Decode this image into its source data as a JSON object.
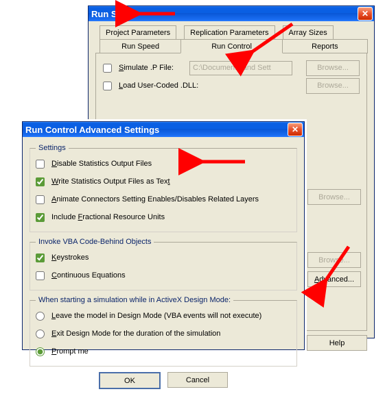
{
  "runSetup": {
    "title": "Run Setup",
    "tabs": {
      "row1": [
        "Project Parameters",
        "Replication Parameters",
        "Array Sizes"
      ],
      "row2": [
        "Run Speed",
        "Run Control",
        "Reports"
      ]
    },
    "simulatePFile": "Simulate .P File:",
    "simulatePath": "C:\\Documents and Sett",
    "loadDll": "Load User-Coded .DLL:",
    "browse": "Browse...",
    "advanced": "Advanced...",
    "help": "Help"
  },
  "adv": {
    "title": "Run Control Advanced Settings",
    "groupSettings": "Settings",
    "disableStats": "Disable Statistics Output Files",
    "writeStatsText": "Write Statistics Output Files as Text",
    "animateConnectors": "Animate Connectors Setting Enables/Disables Related Layers",
    "includeFractional": "Include Fractional Resource Units",
    "groupInvoke": "Invoke VBA Code-Behind Objects",
    "keystrokes": "Keystrokes",
    "continuous": "Continuous Equations",
    "groupStarting": "When starting a simulation while in ActiveX Design Mode:",
    "leaveDesign": "Leave the model in Design Mode (VBA events will not execute)",
    "exitDesign": "Exit Design Mode for the duration of the simulation",
    "promptMe": "Prompt me",
    "ok": "OK",
    "cancel": "Cancel"
  }
}
